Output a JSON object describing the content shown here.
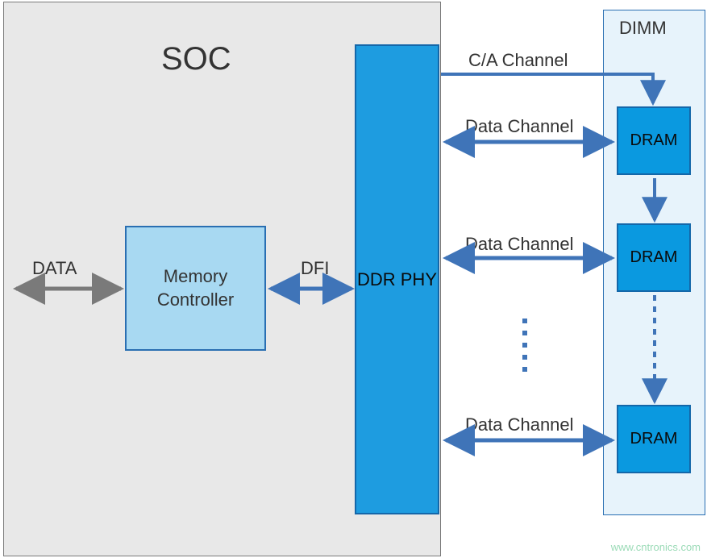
{
  "soc": {
    "title": "SOC"
  },
  "memory_controller": {
    "label": "Memory\nController"
  },
  "ddr_phy": {
    "label": "DDR PHY"
  },
  "dimm": {
    "title": "DIMM"
  },
  "dram": {
    "label": "DRAM"
  },
  "labels": {
    "data": "DATA",
    "dfi": "DFI",
    "ca_channel": "C/A Channel",
    "data_channel": "Data Channel"
  },
  "watermark": "www.cntronics.com",
  "colors": {
    "soc_bg": "#e8e8e8",
    "memctrl_bg": "#a8d9f2",
    "memctrl_border": "#2a6fb2",
    "phy_bg": "#1e9ce0",
    "phy_border": "#1467a9",
    "dimm_bg": "#e7f3fb",
    "dram_bg": "#0a99e0",
    "arrow_blue": "#3f74b8",
    "arrow_gray": "#7a7a7a"
  },
  "chart_data": {
    "type": "table",
    "description": "Block diagram of a DDR memory interface between an SOC and a DIMM module.",
    "blocks": [
      {
        "id": "soc",
        "label": "SOC",
        "contains": [
          "memory_controller",
          "ddr_phy"
        ]
      },
      {
        "id": "memory_controller",
        "label": "Memory Controller",
        "parent": "soc"
      },
      {
        "id": "ddr_phy",
        "label": "DDR PHY",
        "parent": "soc"
      },
      {
        "id": "dimm",
        "label": "DIMM",
        "contains": [
          "dram_0",
          "dram_1",
          "dram_n"
        ]
      },
      {
        "id": "dram_0",
        "label": "DRAM",
        "parent": "dimm"
      },
      {
        "id": "dram_1",
        "label": "DRAM",
        "parent": "dimm"
      },
      {
        "id": "dram_n",
        "label": "DRAM",
        "parent": "dimm",
        "note": "one of N DRAM devices (ellipsis shown)"
      }
    ],
    "connections": [
      {
        "from": "external",
        "to": "memory_controller",
        "label": "DATA",
        "direction": "bidirectional",
        "style": "solid",
        "color": "gray"
      },
      {
        "from": "memory_controller",
        "to": "ddr_phy",
        "label": "DFI",
        "direction": "bidirectional",
        "style": "solid",
        "color": "blue"
      },
      {
        "from": "ddr_phy",
        "to": "dimm",
        "label": "C/A Channel",
        "direction": "unidirectional",
        "style": "solid",
        "color": "blue",
        "note": "command/address fan-out to all DRAMs"
      },
      {
        "from": "ddr_phy",
        "to": "dram_0",
        "label": "Data Channel",
        "direction": "bidirectional",
        "style": "solid",
        "color": "blue"
      },
      {
        "from": "ddr_phy",
        "to": "dram_1",
        "label": "Data Channel",
        "direction": "bidirectional",
        "style": "solid",
        "color": "blue"
      },
      {
        "from": "ddr_phy",
        "to": "dram_n",
        "label": "Data Channel",
        "direction": "bidirectional",
        "style": "solid",
        "color": "blue"
      },
      {
        "from": "dram_0",
        "to": "dram_1",
        "label": "",
        "direction": "unidirectional",
        "style": "solid",
        "color": "blue",
        "note": "C/A daisy-chain"
      },
      {
        "from": "dram_1",
        "to": "dram_n",
        "label": "",
        "direction": "unidirectional",
        "style": "dashed",
        "color": "blue",
        "note": "continuation (ellipsis)"
      }
    ]
  }
}
